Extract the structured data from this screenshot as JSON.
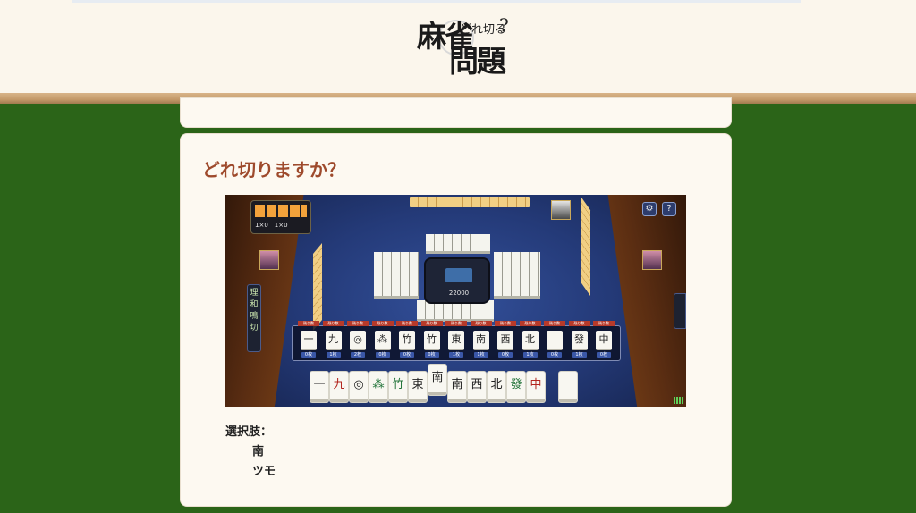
{
  "site": {
    "logo_main_1": "麻雀",
    "logo_main_2": "問題",
    "logo_small": "どれ切る",
    "logo_mark": "?"
  },
  "question": {
    "title": "どれ切りますか？",
    "options_label": "選択肢：",
    "options": [
      "南",
      "ツモ"
    ]
  },
  "game": {
    "scoreboard_counts": "1×0　1×0",
    "center_score": "22000",
    "side_menu": [
      "理",
      "和",
      "鳴",
      "切"
    ],
    "settings_icon": "gear-icon",
    "help_label": "?",
    "remaining_caption": "残り数",
    "remaining": [
      {
        "tile": "一",
        "count": "0枚"
      },
      {
        "tile": "九",
        "count": "1枚"
      },
      {
        "tile": "◎",
        "count": "2枚"
      },
      {
        "tile": "⁂",
        "count": "0枚"
      },
      {
        "tile": "竹",
        "count": "0枚"
      },
      {
        "tile": "竹",
        "count": "0枚"
      },
      {
        "tile": "東",
        "count": "1枚"
      },
      {
        "tile": "南",
        "count": "1枚"
      },
      {
        "tile": "西",
        "count": "0枚"
      },
      {
        "tile": "北",
        "count": "1枚"
      },
      {
        "tile": "",
        "count": "0枚"
      },
      {
        "tile": "發",
        "count": "1枚"
      },
      {
        "tile": "中",
        "count": "0枚"
      }
    ],
    "hand": [
      {
        "tile": "一",
        "color": ""
      },
      {
        "tile": "九",
        "color": "red"
      },
      {
        "tile": "◎",
        "color": ""
      },
      {
        "tile": "⁂",
        "color": "green"
      },
      {
        "tile": "竹",
        "color": "green"
      },
      {
        "tile": "東",
        "color": ""
      },
      {
        "tile": "南",
        "color": "",
        "lifted": true
      },
      {
        "tile": "南",
        "color": ""
      },
      {
        "tile": "西",
        "color": ""
      },
      {
        "tile": "北",
        "color": ""
      },
      {
        "tile": "發",
        "color": "green"
      },
      {
        "tile": "中",
        "color": "red"
      }
    ]
  },
  "colors": {
    "background": "#2b6418",
    "card": "#fdf9f1",
    "title": "#9e4a2c",
    "header_border": "#c49a6a"
  }
}
